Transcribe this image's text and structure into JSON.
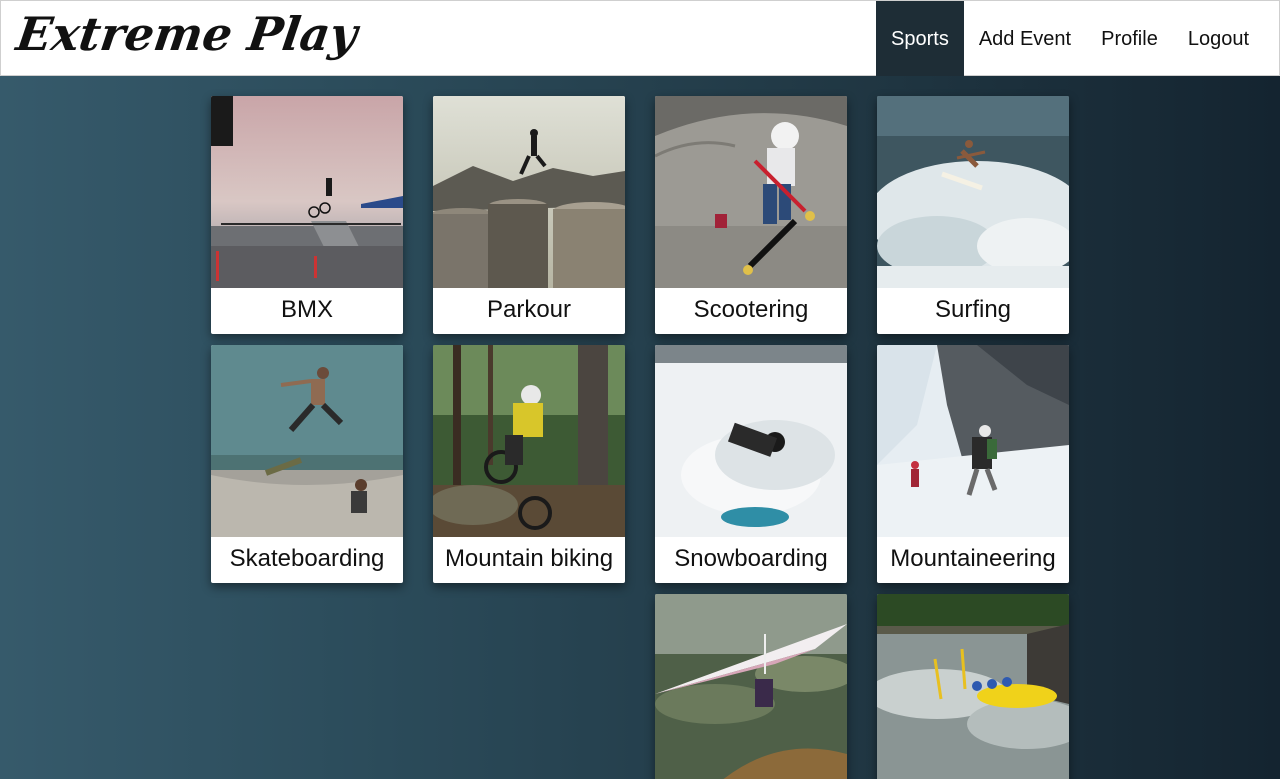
{
  "app": {
    "logo_text": "Extreme Play"
  },
  "nav": {
    "items": [
      {
        "label": "Sports",
        "active": true
      },
      {
        "label": "Add Event",
        "active": false
      },
      {
        "label": "Profile",
        "active": false
      },
      {
        "label": "Logout",
        "active": false
      }
    ]
  },
  "sports": [
    {
      "name": "BMX"
    },
    {
      "name": "Parkour"
    },
    {
      "name": "Scootering"
    },
    {
      "name": "Surfing"
    },
    {
      "name": "Skateboarding"
    },
    {
      "name": "Mountain biking"
    },
    {
      "name": "Snowboarding"
    },
    {
      "name": "Mountaineering"
    },
    {
      "name": ""
    },
    {
      "name": ""
    }
  ],
  "colors": {
    "nav_active_bg": "#1e2d36",
    "page_bg_left": "#365a6b",
    "page_bg_right": "#142430"
  }
}
